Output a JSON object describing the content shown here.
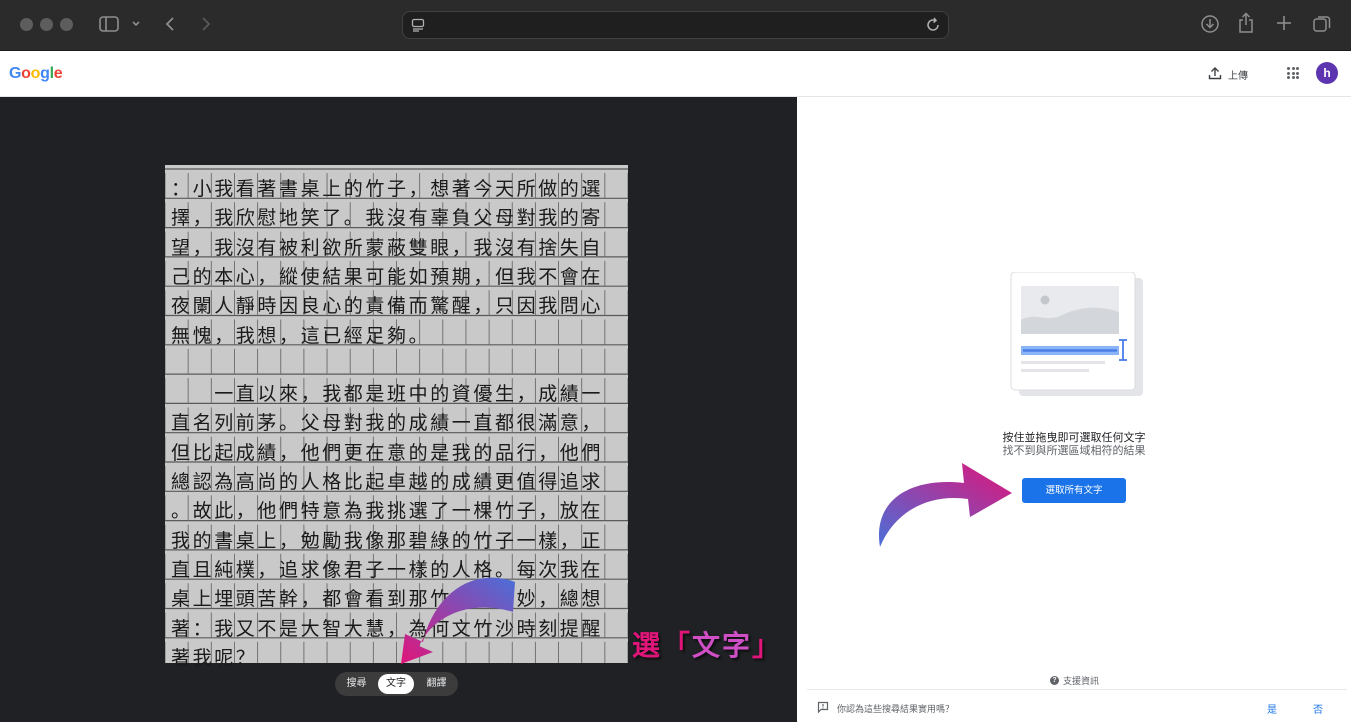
{
  "browser": {
    "address_text": ""
  },
  "google_header": {
    "logo_letters": [
      {
        "char": "G",
        "color": "#4285F4"
      },
      {
        "char": "o",
        "color": "#EA4335"
      },
      {
        "char": "o",
        "color": "#FBBC05"
      },
      {
        "char": "g",
        "color": "#4285F4"
      },
      {
        "char": "l",
        "color": "#34A853"
      },
      {
        "char": "e",
        "color": "#EA4335"
      }
    ],
    "upload_label": "上傳",
    "avatar_letter": "h"
  },
  "handwriting": {
    "lines": [
      "：小我看著書桌上的竹子，想著今天所做的選",
      "擇，我欣慰地笑了。我沒有辜負父母對我的寄",
      "望，我沒有被利欲所蒙蔽雙眼，我沒有捨失自",
      "己的本心，縱使結果可能如預期，但我不會在",
      "夜闌人靜時因良心的責備而驚醒，只因我問心",
      "無愧，我想，這已經足夠。",
      "",
      "　　一直以來，我都是班中的資優生，成績一",
      "直名列前茅。父母對我的成績一直都很滿意，",
      "但比起成績，他們更在意的是我的品行，他們",
      "總認為高尚的人格比起卓越的成績更值得追求",
      "。故此，他們特意為我挑選了一棵竹子，放在",
      "我的書桌上，勉勵我像那碧綠的竹子一樣，正",
      "直且純樸，追求像君子一樣的人格。每次我在",
      "桌上埋頭苦幹，都會看到那竹子，很妙，總想",
      "著：我又不是大智大慧，為何文竹沙時刻提醒",
      "著我呢？"
    ]
  },
  "mode_tabs": [
    {
      "label": "搜尋",
      "active": false
    },
    {
      "label": "文字",
      "active": true
    },
    {
      "label": "翻譯",
      "active": false
    }
  ],
  "annotation": {
    "prefix": "選「",
    "word": "文字",
    "suffix": "」"
  },
  "panel": {
    "main_text": "按住並拖曳即可選取任何文字",
    "sub_text": "找不到與所選區域相符的結果",
    "select_all_button": "選取所有文字",
    "support_label": "支援資訊",
    "feedback_question": "你認為這些搜尋結果實用嗎？",
    "feedback_yes": "是",
    "feedback_no": "否"
  },
  "colors": {
    "accent_blue": "#1a73e8",
    "annotation_pink": "#e0157a",
    "arrow_start": "#4a6fd8",
    "arrow_end": "#e0157a"
  }
}
